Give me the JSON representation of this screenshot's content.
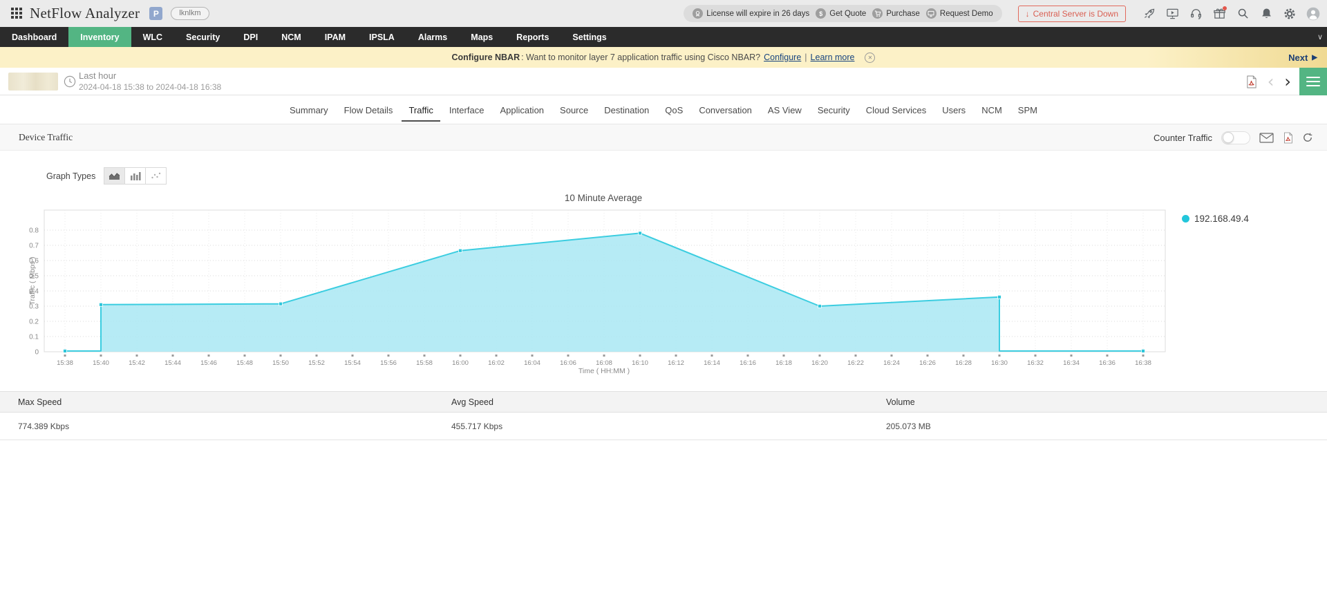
{
  "topbar": {
    "app_title": "NetFlow Analyzer",
    "badge": "P",
    "user_tag": "lknlkm",
    "license_notice": "License will expire in 26 days",
    "get_quote": "Get Quote",
    "purchase": "Purchase",
    "request_demo": "Request Demo",
    "central_server": "Central Server is Down"
  },
  "nav": {
    "items": [
      "Dashboard",
      "Inventory",
      "WLC",
      "Security",
      "DPI",
      "NCM",
      "IPAM",
      "IPSLA",
      "Alarms",
      "Maps",
      "Reports",
      "Settings"
    ],
    "active": "Inventory"
  },
  "banner": {
    "bold": "Configure NBAR",
    "text": ": Want to monitor layer 7 application traffic using Cisco NBAR?",
    "link_configure": "Configure",
    "sep": "|",
    "link_learn": "Learn more",
    "next": "Next"
  },
  "subheader": {
    "period": "Last hour",
    "range": "2024-04-18 15:38 to 2024-04-18 16:38"
  },
  "tabs": {
    "items": [
      "Summary",
      "Flow Details",
      "Traffic",
      "Interface",
      "Application",
      "Source",
      "Destination",
      "QoS",
      "Conversation",
      "AS View",
      "Security",
      "Cloud Services",
      "Users",
      "NCM",
      "SPM"
    ],
    "active": "Traffic"
  },
  "section": {
    "title": "Device Traffic",
    "counter_label": "Counter Traffic"
  },
  "graph_types_label": "Graph Types",
  "chart_data": {
    "type": "area",
    "title": "10 Minute Average",
    "xlabel": "Time ( HH:MM )",
    "ylabel": "Traffic ( Mbps )",
    "ylim": [
      0,
      0.93
    ],
    "yticks": [
      0,
      0.1,
      0.2,
      0.3,
      0.4,
      0.5,
      0.6,
      0.7,
      0.8
    ],
    "x_ticks": [
      "15:38",
      "15:40",
      "15:42",
      "15:44",
      "15:46",
      "15:48",
      "15:50",
      "15:52",
      "15:54",
      "15:56",
      "15:58",
      "16:00",
      "16:02",
      "16:04",
      "16:06",
      "16:08",
      "16:10",
      "16:12",
      "16:14",
      "16:16",
      "16:18",
      "16:20",
      "16:22",
      "16:24",
      "16:26",
      "16:28",
      "16:30",
      "16:32",
      "16:34",
      "16:36",
      "16:38"
    ],
    "grid": true,
    "legend_position": "right",
    "series": [
      {
        "name": "192.168.49.4",
        "color": "#3bcde0",
        "fill": "#a9e7f3",
        "points": [
          [
            "15:38",
            0.005
          ],
          [
            "15:40",
            0.005
          ],
          [
            "15:40",
            0.31
          ],
          [
            "15:50",
            0.315
          ],
          [
            "16:00",
            0.665
          ],
          [
            "16:10",
            0.78
          ],
          [
            "16:20",
            0.3
          ],
          [
            "16:30",
            0.36
          ],
          [
            "16:30",
            0.005
          ],
          [
            "16:38",
            0.005
          ]
        ],
        "markers": [
          [
            "15:38",
            0.005
          ],
          [
            "15:40",
            0.31
          ],
          [
            "15:50",
            0.315
          ],
          [
            "16:00",
            0.665
          ],
          [
            "16:10",
            0.78
          ],
          [
            "16:20",
            0.3
          ],
          [
            "16:30",
            0.36
          ],
          [
            "16:38",
            0.005
          ]
        ]
      }
    ]
  },
  "table": {
    "headers": [
      "Max Speed",
      "Avg Speed",
      "Volume"
    ],
    "rows": [
      [
        "774.389 Kbps",
        "455.717 Kbps",
        "205.073 MB"
      ]
    ]
  },
  "colors": {
    "accent_green": "#53b583",
    "chart_cyan": "#3bcde0",
    "chart_fill": "#a9e7f3",
    "banner_yellow": "#fcf1c7",
    "alert_red": "#d95f52",
    "nav_dark": "#2b2b2b"
  }
}
